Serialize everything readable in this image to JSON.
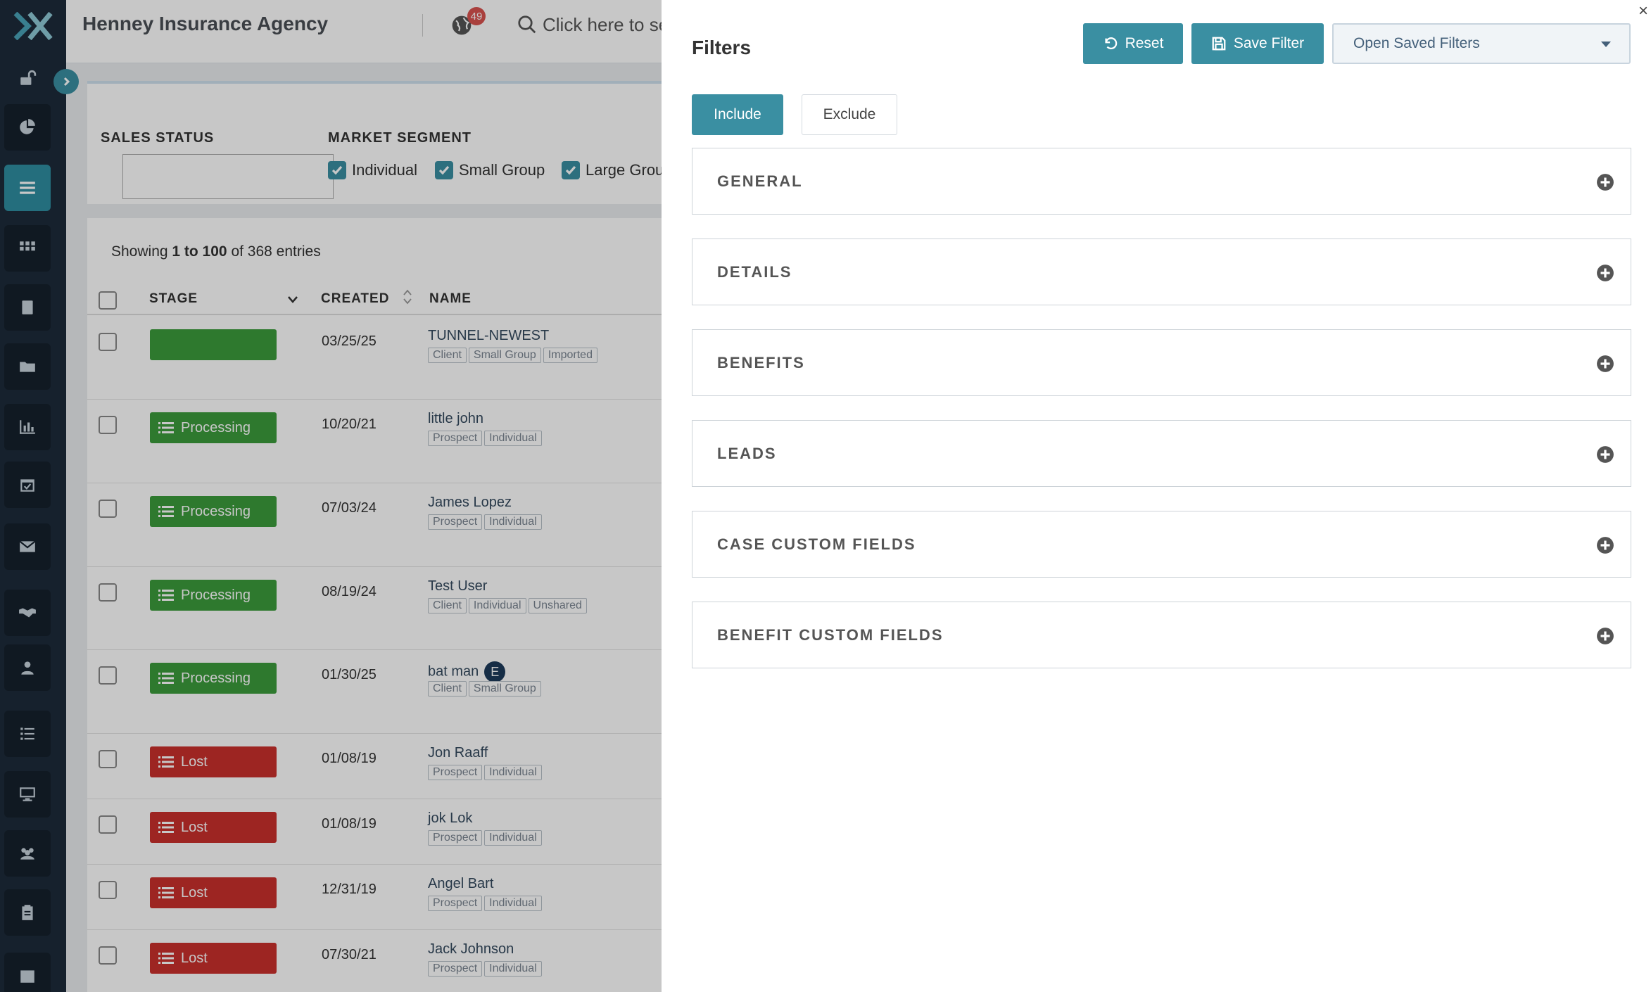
{
  "header": {
    "agency_name": "Henney Insurance Agency",
    "notification_count": "49",
    "search_text": "Click here to se"
  },
  "filter_strip": {
    "sales_status_label": "SALES STATUS",
    "market_segment_label": "MARKET SEGMENT",
    "segments": [
      {
        "label": "Individual",
        "checked": true
      },
      {
        "label": "Small Group",
        "checked": true
      },
      {
        "label": "Large Grou",
        "checked": true
      }
    ]
  },
  "table": {
    "showing_prefix": "Showing ",
    "showing_range": "1 to 100",
    "showing_suffix": " of 368 entries",
    "columns": {
      "stage": "STAGE",
      "created": "CREATED",
      "name": "NAME"
    },
    "rows": [
      {
        "stage": "",
        "stage_color": "green",
        "created": "03/25/25",
        "name": "TUNNEL-NEWEST",
        "tags": [
          "Client",
          "Small Group",
          "Imported"
        ]
      },
      {
        "stage": "Processing",
        "stage_color": "green",
        "created": "10/20/21",
        "name": "little john",
        "tags": [
          "Prospect",
          "Individual"
        ]
      },
      {
        "stage": "Processing",
        "stage_color": "green",
        "created": "07/03/24",
        "name": "James Lopez",
        "tags": [
          "Prospect",
          "Individual"
        ]
      },
      {
        "stage": "Processing",
        "stage_color": "green",
        "created": "08/19/24",
        "name": "Test User",
        "tags": [
          "Client",
          "Individual",
          "Unshared"
        ]
      },
      {
        "stage": "Processing",
        "stage_color": "green",
        "created": "01/30/25",
        "name": "bat man",
        "badge": "E",
        "tags": [
          "Client",
          "Small Group"
        ]
      },
      {
        "stage": "Lost",
        "stage_color": "red",
        "created": "01/08/19",
        "name": "Jon Raaff",
        "tags": [
          "Prospect",
          "Individual"
        ]
      },
      {
        "stage": "Lost",
        "stage_color": "red",
        "created": "01/08/19",
        "name": "jok Lok",
        "tags": [
          "Prospect",
          "Individual"
        ]
      },
      {
        "stage": "Lost",
        "stage_color": "red",
        "created": "12/31/19",
        "name": "Angel Bart",
        "tags": [
          "Prospect",
          "Individual"
        ]
      },
      {
        "stage": "Lost",
        "stage_color": "red",
        "created": "07/30/21",
        "name": "Jack Johnson",
        "tags": [
          "Prospect",
          "Individual"
        ]
      }
    ]
  },
  "filters_panel": {
    "close": "×",
    "title": "Filters",
    "reset_label": "Reset",
    "save_filter_label": "Save Filter",
    "open_saved_label": "Open Saved Filters",
    "include_label": "Include",
    "exclude_label": "Exclude",
    "sections": [
      "GENERAL",
      "DETAILS",
      "BENEFITS",
      "LEADS",
      "CASE CUSTOM FIELDS",
      "BENEFIT CUSTOM FIELDS"
    ]
  },
  "colors": {
    "accent": "#3a8fa2",
    "sidebar_bg": "#1d2b3a",
    "stage_green": "#3c9b3c",
    "stage_red": "#c9302c"
  },
  "sidebar_icons": [
    "unlock-icon",
    "pie-chart-icon",
    "list-icon",
    "grid-icon",
    "book-icon",
    "folder-icon",
    "bar-chart-icon",
    "calendar-check-icon",
    "envelope-icon",
    "handshake-icon",
    "user-icon",
    "list-ul-icon",
    "desktop-icon",
    "users-icon",
    "clipboard-icon",
    "calendar-icon"
  ]
}
